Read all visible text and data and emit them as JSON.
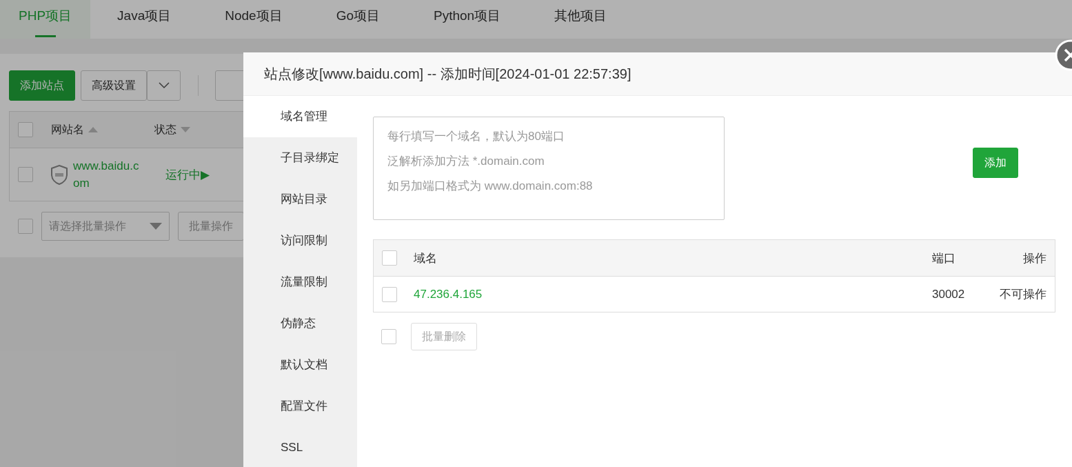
{
  "project_tabs": [
    {
      "label": "PHP项目",
      "selected": true
    },
    {
      "label": "Java项目",
      "selected": false
    },
    {
      "label": "Node项目",
      "selected": false
    },
    {
      "label": "Go项目",
      "selected": false
    },
    {
      "label": "Python项目",
      "selected": false
    },
    {
      "label": "其他项目",
      "selected": false
    }
  ],
  "toolbar": {
    "add_site": "添加站点",
    "advanced": "高级设置"
  },
  "sites_table": {
    "columns": [
      "网站名",
      "状态"
    ],
    "select_all_checked": false,
    "rows": [
      {
        "name": "www.baidu.c\nom",
        "status": "运行中▶",
        "checked": false
      }
    ]
  },
  "batch": {
    "checked": false,
    "select_placeholder": "请选择批量操作",
    "button": "批量操作"
  },
  "dialog": {
    "title": "站点修改[www.baidu.com] -- 添加时间[2024-01-01 22:57:39]",
    "nav": [
      {
        "label": "域名管理",
        "selected": true
      },
      {
        "label": "子目录绑定",
        "selected": false
      },
      {
        "label": "网站目录",
        "selected": false
      },
      {
        "label": "访问限制",
        "selected": false
      },
      {
        "label": "流量限制",
        "selected": false
      },
      {
        "label": "伪静态",
        "selected": false
      },
      {
        "label": "默认文档",
        "selected": false
      },
      {
        "label": "配置文件",
        "selected": false
      },
      {
        "label": "SSL",
        "selected": false
      }
    ],
    "domain_input": {
      "placeholder_lines": [
        "每行填写一个域名，默认为80端口",
        "泛解析添加方法 *.domain.com",
        "如另加端口格式为 www.domain.com:88"
      ]
    },
    "add_button": "添加",
    "domain_table": {
      "columns": [
        "域名",
        "端口",
        "操作"
      ],
      "select_all_checked": false,
      "rows": [
        {
          "domain": "47.236.4.165",
          "port": "30002",
          "action": "不可操作",
          "checked": false
        }
      ]
    },
    "batch_delete_checked": false,
    "batch_delete": "批量删除"
  }
}
